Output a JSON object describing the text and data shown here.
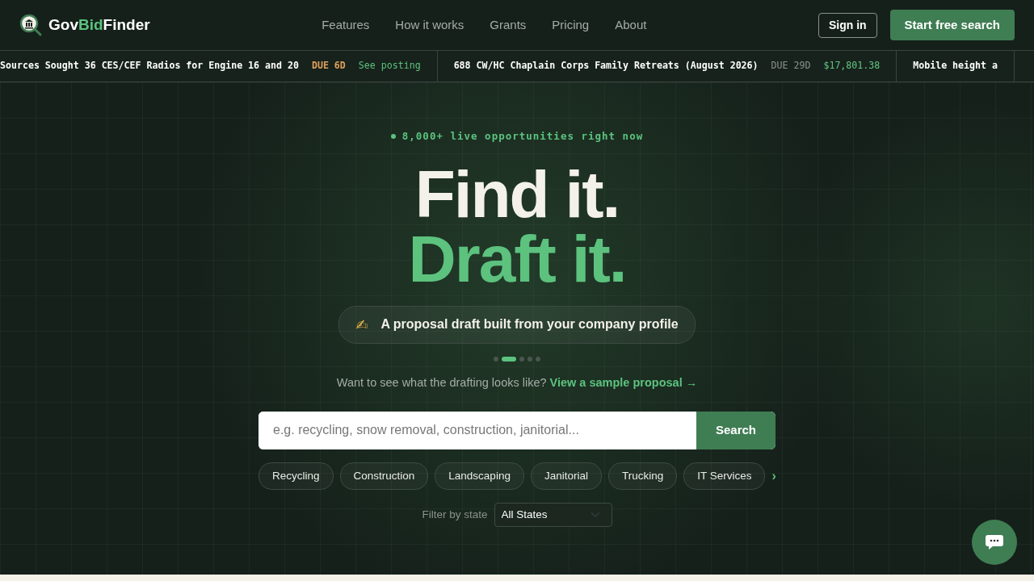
{
  "brand": {
    "parts": [
      {
        "text": "Gov",
        "accent": false
      },
      {
        "text": "Bid",
        "accent": true
      },
      {
        "text": "Finder",
        "accent": false
      }
    ]
  },
  "nav": {
    "links": [
      "Features",
      "How it works",
      "Grants",
      "Pricing",
      "About"
    ],
    "sign_in": "Sign in",
    "cta": "Start free search"
  },
  "ticker": [
    {
      "title": "Sources Sought 36 CES/CEF Radios for Engine 16 and 20",
      "due": "DUE 6D",
      "urgent": true,
      "extra": "See posting",
      "kind": "link"
    },
    {
      "title": "688 CW/HC Chaplain Corps Family Retreats (August 2026)",
      "due": "DUE 29D",
      "urgent": false,
      "extra": "$17,801.38",
      "kind": "amount"
    },
    {
      "title": "Mobile height a"
    }
  ],
  "hero": {
    "badge": "8,000+ live opportunities right now",
    "headline_1": "Find it.",
    "headline_2": "Draft it.",
    "feature": {
      "emoji": "✍",
      "text": "A proposal draft built from your company profile"
    },
    "dots": [
      {
        "selected": false
      },
      {
        "selected": true
      },
      {
        "selected": false
      },
      {
        "selected": false
      },
      {
        "selected": false
      }
    ],
    "sample_prompt": "Want to see what the drafting looks like?",
    "sample_link": "View a sample proposal →"
  },
  "search": {
    "placeholder": "e.g. recycling, snow removal, construction, janitorial...",
    "button": "Search"
  },
  "chips": [
    "Recycling",
    "Construction",
    "Landscaping",
    "Janitorial",
    "Trucking",
    "IT Services"
  ],
  "chips_more": "›",
  "filter": {
    "label": "Filter by state",
    "value": "All States"
  }
}
